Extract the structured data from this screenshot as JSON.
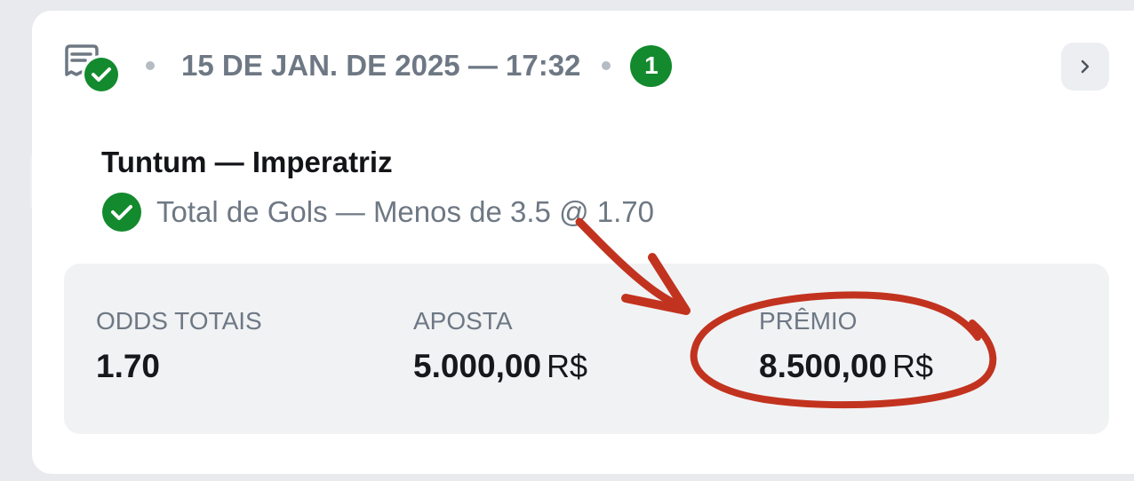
{
  "header": {
    "date_time": "15 DE JAN. DE 2025 — 17:32",
    "selection_count": "1",
    "icon": "receipt-check-icon",
    "nav_icon": "chevron-right-icon"
  },
  "bet": {
    "match": "Tuntum — Imperatriz",
    "selection": "Total de Gols — Menos de 3.5 @ 1.70",
    "status_icon": "check-circle-icon"
  },
  "summary": {
    "odds": {
      "label": "ODDS TOTAIS",
      "value": "1.70"
    },
    "stake": {
      "label": "APOSTA",
      "value": "5.000,00",
      "currency": "R$"
    },
    "prize": {
      "label": "PRÊMIO",
      "value": "8.500,00",
      "currency": "R$"
    }
  },
  "colors": {
    "success_green": "#138a2d",
    "muted_text": "#6e7884",
    "annotation_red": "#c2331f"
  }
}
